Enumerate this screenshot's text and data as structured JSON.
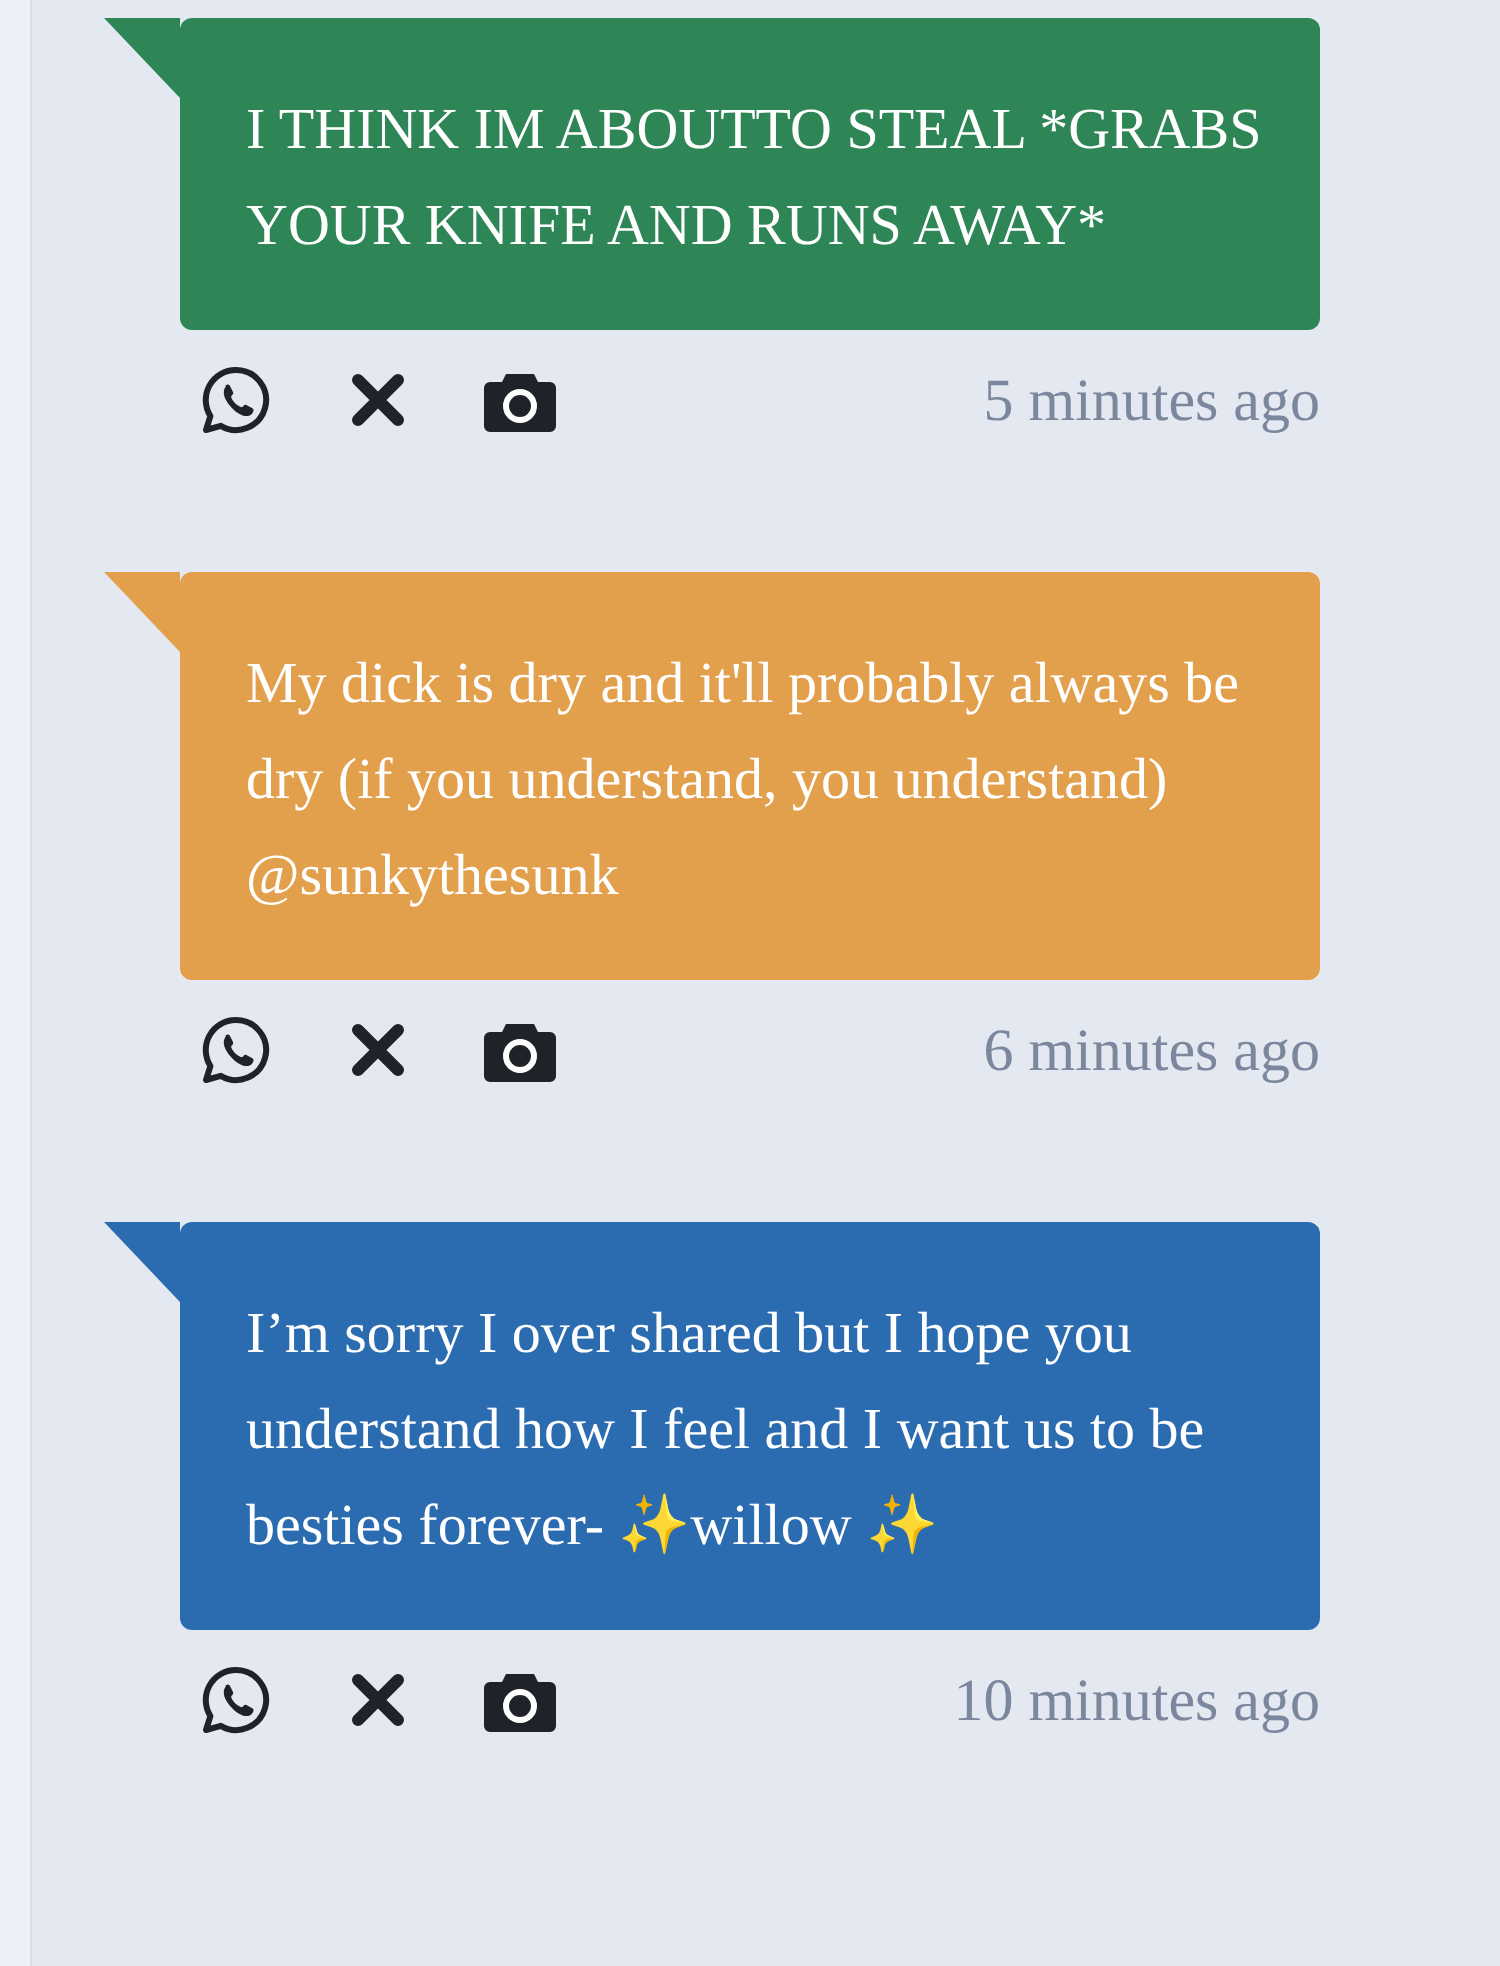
{
  "messages": [
    {
      "text": "I THINK IM ABOUTTO STEAL *GRABS YOUR KNIFE AND RUNS AWAY*",
      "color": "#2e8555",
      "time": "5 minutes ago"
    },
    {
      "text": "My dick is dry and it'll probably always be dry (if you understand, you understand) @sunkythesunk",
      "color": "#e3a04c",
      "time": "6 minutes ago"
    },
    {
      "text": "I’m sorry I over shared but I hope you understand how I feel and I want us to be besties forever- ✨willow ✨",
      "color": "#2b6cb0",
      "time": "10 minutes ago"
    }
  ]
}
